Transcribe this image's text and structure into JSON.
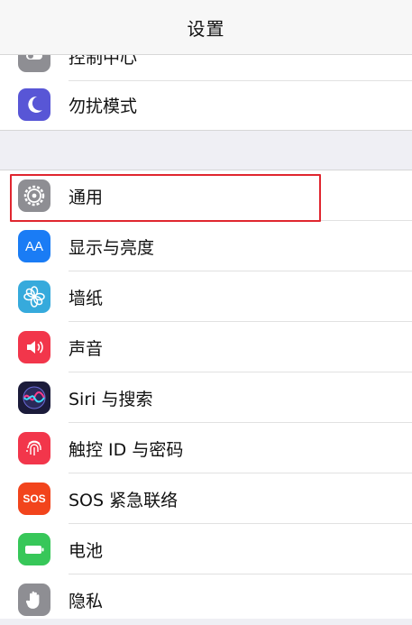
{
  "nav": {
    "title": "设置"
  },
  "group1": [
    {
      "label": "控制中心",
      "icon": "toggle-icon",
      "color": "#8e8e93"
    },
    {
      "label": "勿扰模式",
      "icon": "moon-icon",
      "color": "#5856d6"
    }
  ],
  "group2": [
    {
      "label": "通用",
      "icon": "gear-icon",
      "color": "#8e8e93"
    },
    {
      "label": "显示与亮度",
      "icon": "text-size-icon",
      "color": "#1a7cf5",
      "icon_text": "AA"
    },
    {
      "label": "墙纸",
      "icon": "flower-icon",
      "color": "#36aadc"
    },
    {
      "label": "声音",
      "icon": "speaker-icon",
      "color": "#f2364b"
    },
    {
      "label": "Siri 与搜索",
      "icon": "siri-icon",
      "color": "#1b1b3a"
    },
    {
      "label": "触控 ID 与密码",
      "icon": "fingerprint-icon",
      "color": "#f2364b"
    },
    {
      "label": "SOS 紧急联络",
      "icon": "sos-icon",
      "color": "#f2441c",
      "icon_text": "SOS"
    },
    {
      "label": "电池",
      "icon": "battery-icon",
      "color": "#37c759"
    },
    {
      "label": "隐私",
      "icon": "hand-icon",
      "color": "#8e8e93"
    }
  ],
  "highlight_color": "#e0262f"
}
